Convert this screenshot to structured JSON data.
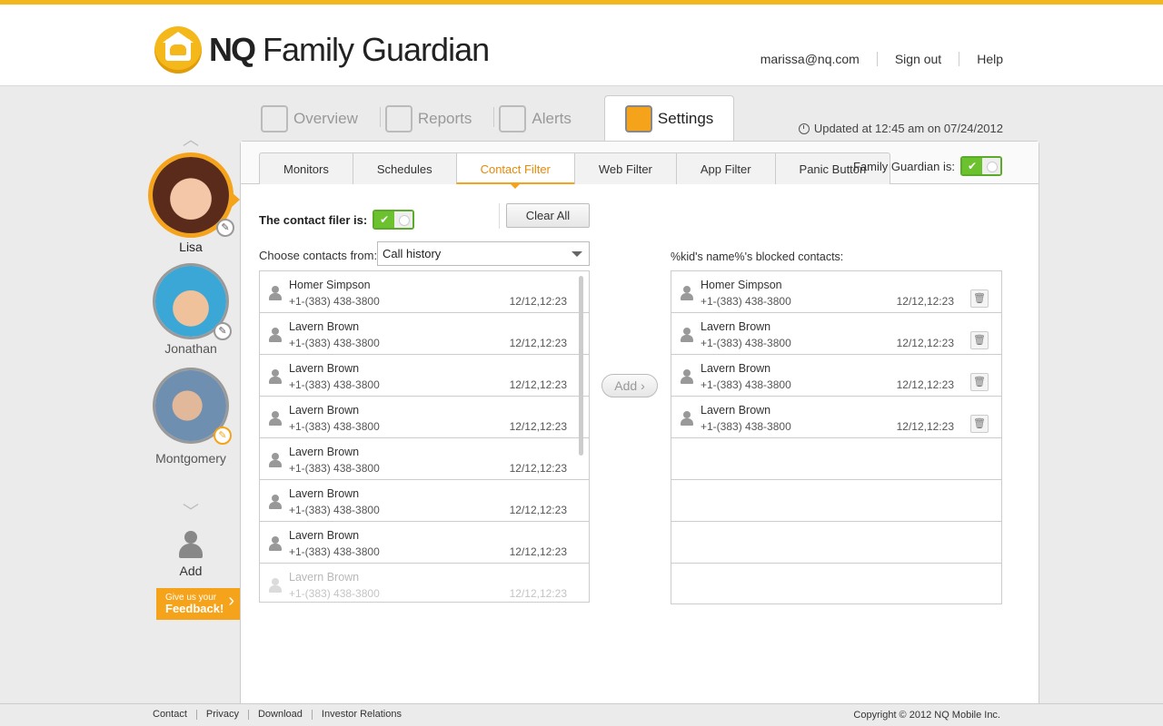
{
  "brand": {
    "name_bold": "NQ",
    "name_rest": "Family Guardian",
    "accent": "#f5a31a"
  },
  "header": {
    "email": "marissa@nq.com",
    "sign_out": "Sign out",
    "help": "Help"
  },
  "kids": [
    {
      "name": "Lisa",
      "active": true,
      "icon": "avatar-lisa"
    },
    {
      "name": "Jonathan",
      "active": false,
      "icon": "avatar-jonathan"
    },
    {
      "name": "Montgomery",
      "active": false,
      "icon": "avatar-montgomery"
    }
  ],
  "sidebar": {
    "add_label": "Add",
    "feedback_line1": "Give us your",
    "feedback_line2": "Feedback!"
  },
  "main_tabs": [
    "Overview",
    "Reports",
    "Alerts",
    "Settings"
  ],
  "updated_text": "Updated at 12:45 am on 07/24/2012",
  "sub_tabs": [
    "Monitors",
    "Schedules",
    "Contact Filter",
    "Web Filter",
    "App Filter",
    "Panic Button"
  ],
  "family_guardian_label": "Family Guardian is:",
  "contact_filter": {
    "label": "The contact filer is:",
    "clear_all": "Clear All",
    "choose_label": "Choose contacts from:",
    "source_selected": "Call history",
    "add_button": "Add",
    "blocked_label": "%kid's name%'s blocked contacts:"
  },
  "available_contacts": [
    {
      "name": "Homer Simpson",
      "phone": "+1-(383) 438-3800",
      "date": "12/12,12:23"
    },
    {
      "name": "Lavern Brown",
      "phone": "+1-(383) 438-3800",
      "date": "12/12,12:23"
    },
    {
      "name": "Lavern Brown",
      "phone": "+1-(383) 438-3800",
      "date": "12/12,12:23"
    },
    {
      "name": "Lavern Brown",
      "phone": "+1-(383) 438-3800",
      "date": "12/12,12:23"
    },
    {
      "name": "Lavern Brown",
      "phone": "+1-(383) 438-3800",
      "date": "12/12,12:23"
    },
    {
      "name": "Lavern Brown",
      "phone": "+1-(383) 438-3800",
      "date": "12/12,12:23"
    },
    {
      "name": "Lavern Brown",
      "phone": "+1-(383) 438-3800",
      "date": "12/12,12:23"
    },
    {
      "name": "Lavern Brown",
      "phone": "+1-(383) 438-3800",
      "date": "12/12,12:23"
    }
  ],
  "blocked_contacts": [
    {
      "name": "Homer Simpson",
      "phone": "+1-(383) 438-3800",
      "date": "12/12,12:23"
    },
    {
      "name": "Lavern Brown",
      "phone": "+1-(383) 438-3800",
      "date": "12/12,12:23"
    },
    {
      "name": "Lavern Brown",
      "phone": "+1-(383) 438-3800",
      "date": "12/12,12:23"
    },
    {
      "name": "Lavern Brown",
      "phone": "+1-(383) 438-3800",
      "date": "12/12,12:23"
    }
  ],
  "footer": {
    "links": [
      "Contact",
      "Privacy",
      "Download",
      "Investor Relations"
    ],
    "copyright": "Copyright © 2012 NQ Mobile Inc."
  }
}
